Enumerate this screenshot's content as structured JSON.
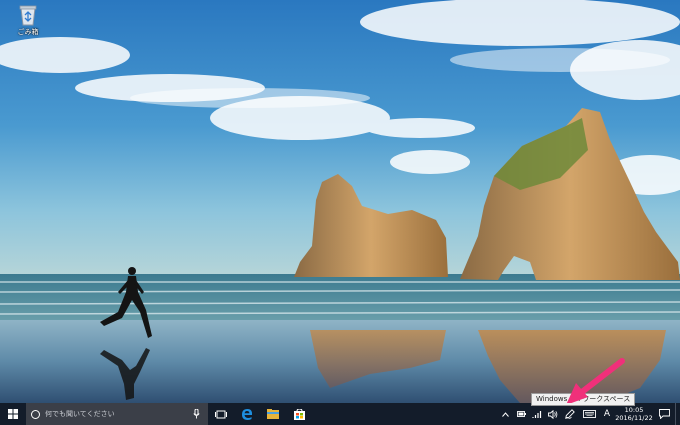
{
  "desktop": {
    "recycle_bin_label": "ごみ箱",
    "tooltip": "Windows Ink ワークスペース"
  },
  "taskbar": {
    "search_placeholder": "何でも聞いてください",
    "pinned": [
      "task-view",
      "edge",
      "file-explorer",
      "store"
    ],
    "tray": {
      "ime_mode": "A",
      "time": "10:05",
      "date": "2016/11/22"
    }
  },
  "colors": {
    "taskbar": "#131c2a",
    "search_box": "#3b3f48",
    "annotation_arrow": "#f0307a",
    "edge_blue": "#1e8fe0"
  },
  "icons": [
    "recycle-bin-icon",
    "windows-logo-icon",
    "search-circle-icon",
    "microphone-icon",
    "task-view-icon",
    "edge-icon",
    "file-explorer-icon",
    "store-icon",
    "chevron-up-icon",
    "battery-icon",
    "wifi-icon",
    "speaker-icon",
    "windows-ink-pen-icon",
    "touch-keyboard-icon",
    "notifications-icon"
  ]
}
